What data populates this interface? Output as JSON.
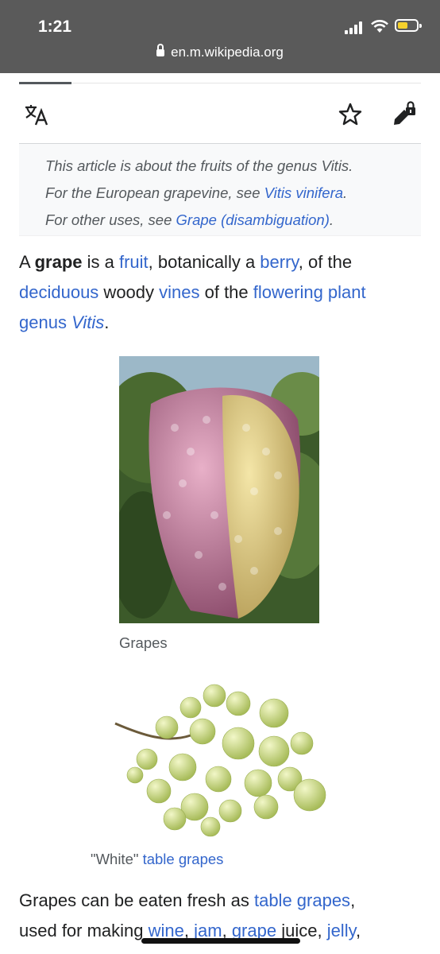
{
  "status": {
    "time": "1:21",
    "url": "en.m.wikipedia.org"
  },
  "toolbar": {
    "language_icon": "translate-icon",
    "watch_icon": "star-icon",
    "edit_icon": "edit-locked-icon"
  },
  "hatnote": {
    "line1": "This article is about the fruits of the genus Vitis.",
    "line2_pre": "For the European grapevine, see ",
    "line2_link": "Vitis vinifera",
    "line2_post": ".",
    "line3_pre": "For other uses, see ",
    "line3_link": "Grape (disambiguation)",
    "line3_post": "."
  },
  "lead": {
    "t1": "A ",
    "bold": "grape",
    "t2": " is a ",
    "l1": "fruit",
    "t3": ", botanically a ",
    "l2": "berry",
    "t4": ", of the ",
    "l3": "deciduous",
    "t5": " woody ",
    "l4": "vines",
    "t6": " of the ",
    "l5": "flowering plant",
    "t7": " ",
    "l6a": "genus ",
    "l6b": "Vitis",
    "t8": "."
  },
  "figure1": {
    "caption": "Grapes"
  },
  "figure2": {
    "caption_pre": "\"White\" ",
    "caption_link": "table grapes"
  },
  "para2": {
    "t1": "Grapes can be eaten fresh as ",
    "l1": "table grapes",
    "t2": ",",
    "t3": "used for making ",
    "l2": "wine",
    "t4": ", ",
    "l3": "jam",
    "t5": ", ",
    "l4": "grape",
    "t6": " juice, ",
    "l5": "jelly",
    "t7": ","
  }
}
